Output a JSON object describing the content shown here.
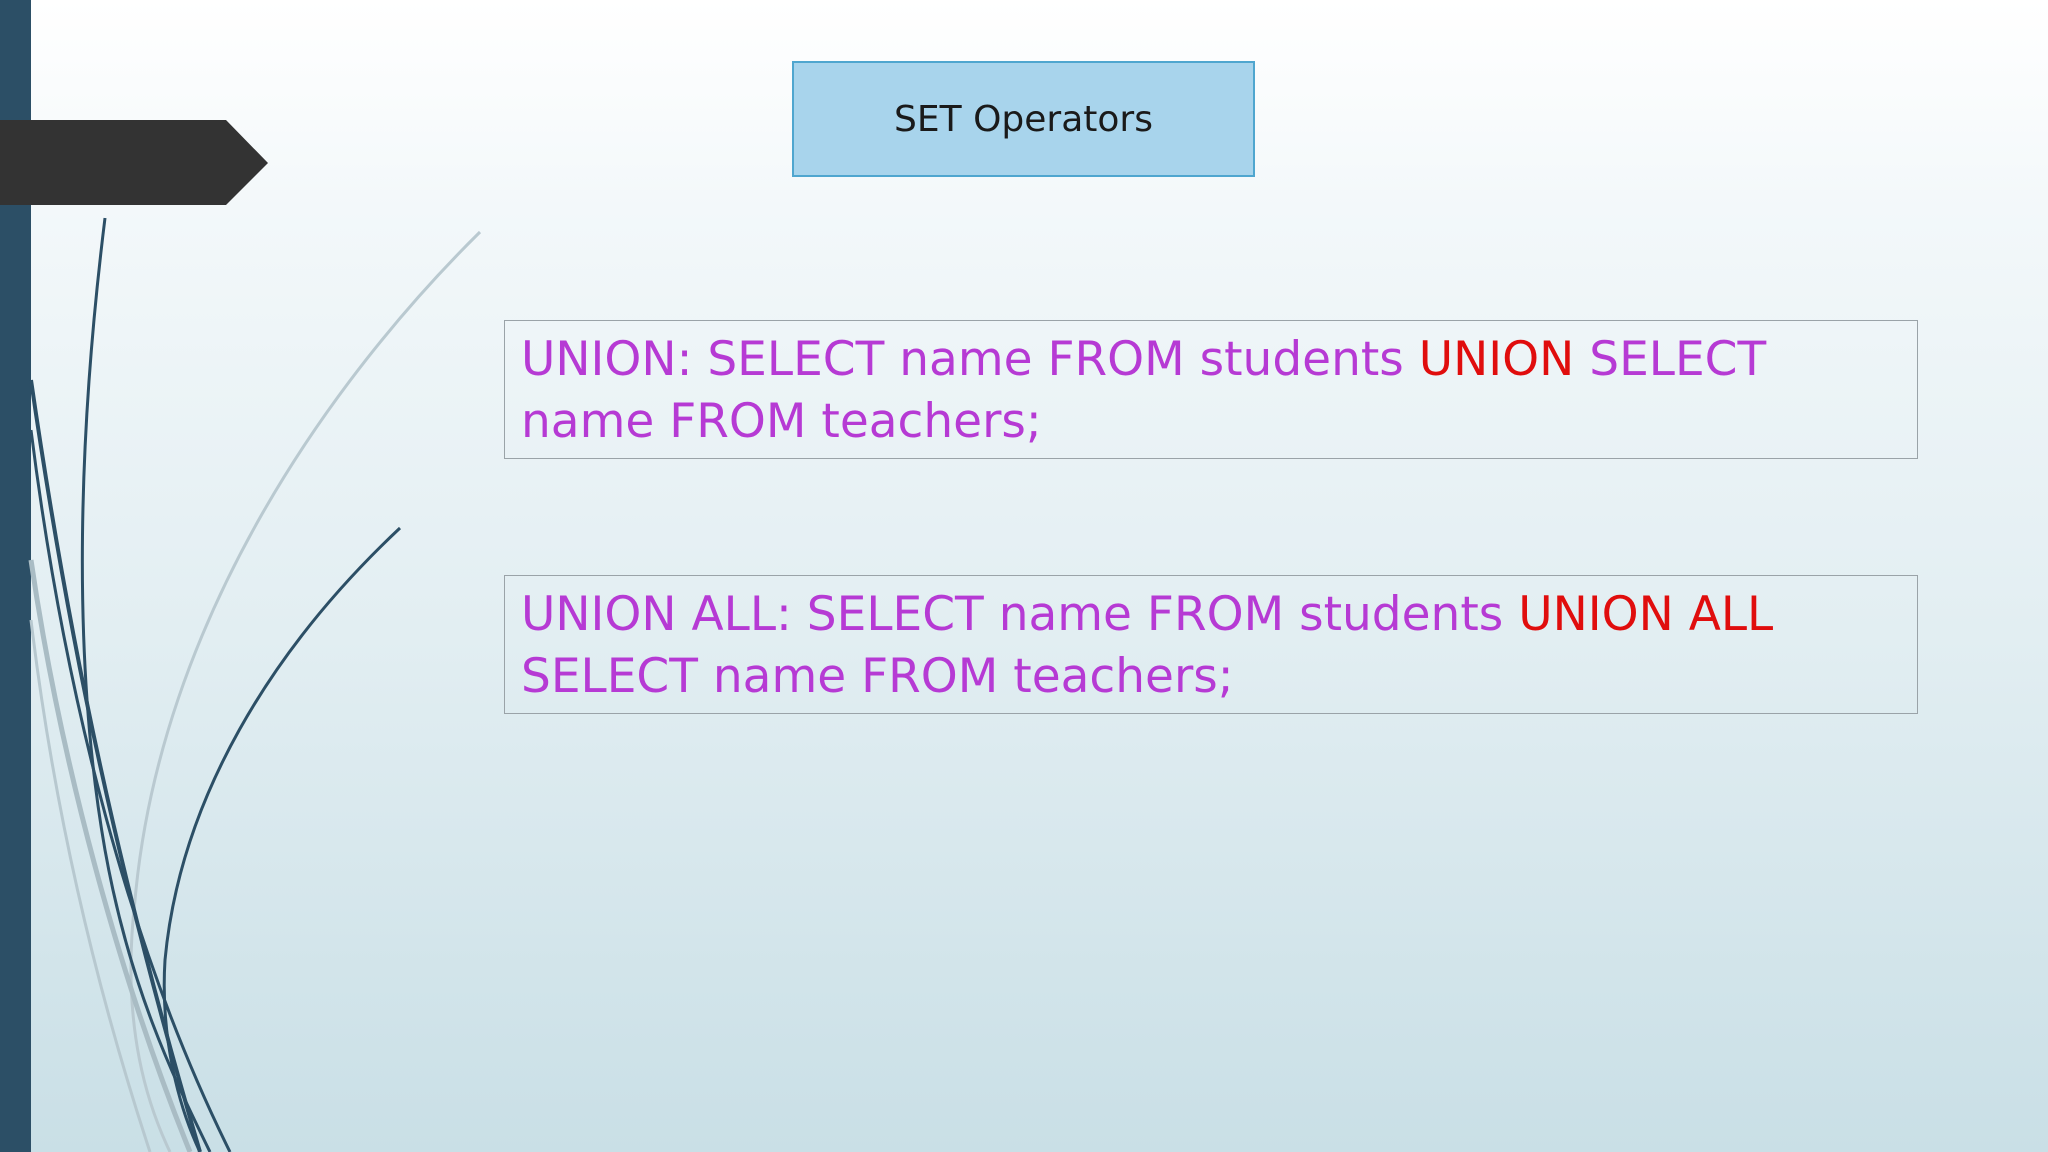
{
  "slide": {
    "title": "SET Operators",
    "examples": [
      {
        "line1_prefix": "UNION: SELECT name FROM students ",
        "line1_keyword": "UNION",
        "line1_suffix": " SELECT",
        "line2": "name FROM teachers;"
      },
      {
        "line1_prefix": "UNION ALL: SELECT name FROM students ",
        "line1_keyword": "UNION ALL",
        "line1_suffix": "",
        "line2": "SELECT name FROM teachers;"
      }
    ]
  },
  "colors": {
    "code_text": "#b63ad4",
    "keyword": "#e00d0d",
    "title_fill": "#a8d4ec",
    "title_border": "#4fa6cf",
    "left_bar": "#2c4f66",
    "arrow_tab": "#333333"
  }
}
